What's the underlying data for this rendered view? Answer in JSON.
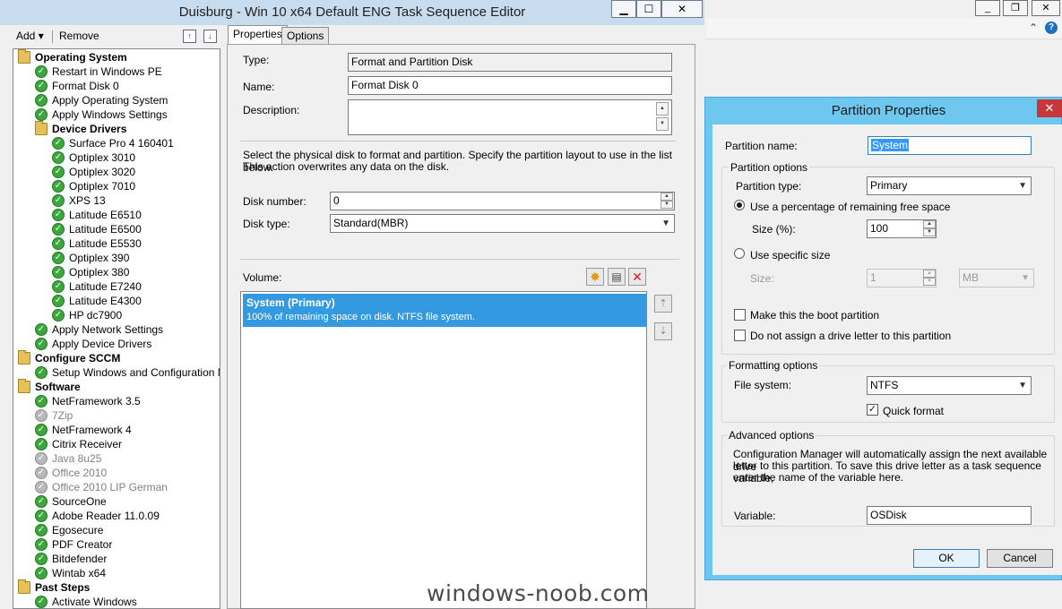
{
  "editor": {
    "title": "Duisburg - Win 10 x64 Default ENG Task Sequence Editor",
    "caption": {
      "minimize": "▁",
      "maximize": "☐",
      "close": "✕"
    },
    "toolbar": {
      "add": "Add",
      "add_arrow": "▾",
      "remove": "Remove",
      "move_up_icon": "move-up-icon",
      "move_down_icon": "move-down-icon"
    },
    "tabs": {
      "properties": "Properties",
      "options": "Options"
    }
  },
  "tree": [
    {
      "label": "Operating System",
      "kind": "group",
      "level": 0
    },
    {
      "label": "Restart in Windows PE",
      "kind": "step",
      "level": 1
    },
    {
      "label": "Format Disk 0",
      "kind": "step",
      "level": 1
    },
    {
      "label": "Apply Operating System",
      "kind": "step",
      "level": 1
    },
    {
      "label": "Apply Windows Settings",
      "kind": "step",
      "level": 1
    },
    {
      "label": "Device Drivers",
      "kind": "group",
      "level": 1
    },
    {
      "label": "Surface Pro 4 160401",
      "kind": "step",
      "level": 2
    },
    {
      "label": "Optiplex 3010",
      "kind": "step",
      "level": 2
    },
    {
      "label": "Optiplex 3020",
      "kind": "step",
      "level": 2
    },
    {
      "label": "Optiplex 7010",
      "kind": "step",
      "level": 2
    },
    {
      "label": "XPS 13",
      "kind": "step",
      "level": 2
    },
    {
      "label": "Latitude E6510",
      "kind": "step",
      "level": 2
    },
    {
      "label": "Latitude E6500",
      "kind": "step",
      "level": 2
    },
    {
      "label": "Latitude E5530",
      "kind": "step",
      "level": 2
    },
    {
      "label": "Optiplex 390",
      "kind": "step",
      "level": 2
    },
    {
      "label": "Optiplex 380",
      "kind": "step",
      "level": 2
    },
    {
      "label": "Latitude E7240",
      "kind": "step",
      "level": 2
    },
    {
      "label": "Latitude E4300",
      "kind": "step",
      "level": 2
    },
    {
      "label": "HP dc7900",
      "kind": "step",
      "level": 2
    },
    {
      "label": "Apply Network Settings",
      "kind": "step",
      "level": 1
    },
    {
      "label": "Apply Device Drivers",
      "kind": "step",
      "level": 1
    },
    {
      "label": "Configure SCCM",
      "kind": "group",
      "level": 0
    },
    {
      "label": "Setup Windows and Configuration Manager",
      "kind": "step",
      "level": 1
    },
    {
      "label": "Software",
      "kind": "group",
      "level": 0
    },
    {
      "label": "NetFramework 3.5",
      "kind": "step",
      "level": 1
    },
    {
      "label": "7Zip",
      "kind": "disabled",
      "level": 1
    },
    {
      "label": "NetFramework 4",
      "kind": "step",
      "level": 1
    },
    {
      "label": "Citrix Receiver",
      "kind": "step",
      "level": 1
    },
    {
      "label": "Java 8u25",
      "kind": "disabled",
      "level": 1
    },
    {
      "label": "Office 2010",
      "kind": "disabled",
      "level": 1
    },
    {
      "label": "Office 2010 LIP German",
      "kind": "disabled",
      "level": 1
    },
    {
      "label": "SourceOne",
      "kind": "step",
      "level": 1
    },
    {
      "label": "Adobe Reader 11.0.09",
      "kind": "step",
      "level": 1
    },
    {
      "label": "Egosecure",
      "kind": "step",
      "level": 1
    },
    {
      "label": "PDF Creator",
      "kind": "step",
      "level": 1
    },
    {
      "label": "Bitdefender",
      "kind": "step",
      "level": 1
    },
    {
      "label": "Wintab x64",
      "kind": "step",
      "level": 1
    },
    {
      "label": "Past Steps",
      "kind": "group",
      "level": 0
    },
    {
      "label": "Activate Windows",
      "kind": "step",
      "level": 1
    }
  ],
  "properties": {
    "type_label": "Type:",
    "type_value": "Format and Partition Disk",
    "name_label": "Name:",
    "name_value": "Format Disk 0",
    "description_label": "Description:",
    "description_value": "",
    "instructions_line1": "Select the physical disk to format and partition. Specify the partition layout to use in the list below.",
    "instructions_line2": "This action overwrites any data on the disk.",
    "disk_number_label": "Disk number:",
    "disk_number_value": "0",
    "disk_type_label": "Disk type:",
    "disk_type_value": "Standard(MBR)",
    "volume_label": "Volume:",
    "volume_item_title": "System (Primary)",
    "volume_item_desc": "100% of remaining space on disk. NTFS file system.",
    "icons": {
      "new": "new-partition-icon",
      "properties": "partition-properties-icon",
      "delete": "delete-icon"
    }
  },
  "dialog": {
    "title": "Partition Properties",
    "close": "✕",
    "partition_name_label": "Partition name:",
    "partition_name_value": "System",
    "partition_options_title": "Partition options",
    "partition_type_label": "Partition type:",
    "partition_type_value": "Primary",
    "percent_option_label": "Use a percentage of remaining free space",
    "size_percent_label": "Size (%):",
    "size_percent_value": "100",
    "specific_size_label": "Use specific size",
    "size_label": "Size:",
    "size_value": "1",
    "size_unit": "MB",
    "boot_partition_label": "Make this the boot partition",
    "no_drive_letter_label": "Do not assign a drive letter to this partition",
    "formatting_title": "Formatting options",
    "file_system_label": "File system:",
    "file_system_value": "NTFS",
    "quick_format_label": "Quick format",
    "advanced_title": "Advanced options",
    "advanced_line1": "Configuration Manager will automatically assign the next available drive",
    "advanced_line2": "letter to this partition. To save this drive letter as a task sequence variable,",
    "advanced_line3": "enter the name of the variable here.",
    "variable_label": "Variable:",
    "variable_value": "OSDisk",
    "ok": "OK",
    "cancel": "Cancel"
  },
  "background_window": {
    "caption": {
      "minimize": "_",
      "restore": "❐",
      "close": "✕"
    },
    "collapse": "⌃",
    "help": "?"
  },
  "watermark": "windows-noob.com"
}
